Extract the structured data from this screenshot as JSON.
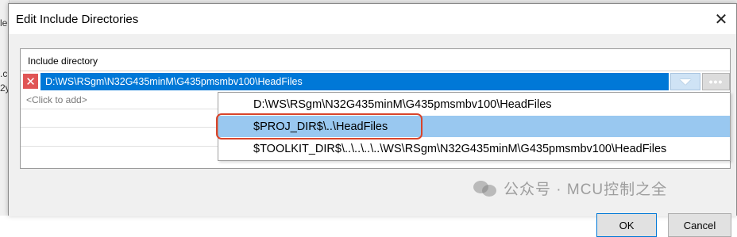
{
  "dialog": {
    "title": "Edit Include Directories",
    "close_icon": "close-icon"
  },
  "background": {
    "left_fragments": [
      "le",
      ".c",
      "2y"
    ]
  },
  "grid": {
    "header": "Include directory",
    "edit_value": "D:\\WS\\RSgm\\N32G435minM\\G435pmsmbv100\\HeadFiles",
    "add_placeholder": "<Click to add>",
    "more_label": "•••"
  },
  "dropdown": {
    "options": [
      "D:\\WS\\RSgm\\N32G435minM\\G435pmsmbv100\\HeadFiles",
      "$PROJ_DIR$\\..\\HeadFiles",
      "$TOOLKIT_DIR$\\..\\..\\..\\..\\WS\\RSgm\\N32G435minM\\G435pmsmbv100\\HeadFiles"
    ],
    "selected_index": 1
  },
  "buttons": {
    "ok": "OK",
    "cancel": "Cancel"
  },
  "watermark": {
    "text": "公众号 · MCU控制之全"
  },
  "colors": {
    "accent": "#0078d7",
    "selection": "#99c8f0",
    "annotation": "#d9442a",
    "delete": "#e05555"
  }
}
